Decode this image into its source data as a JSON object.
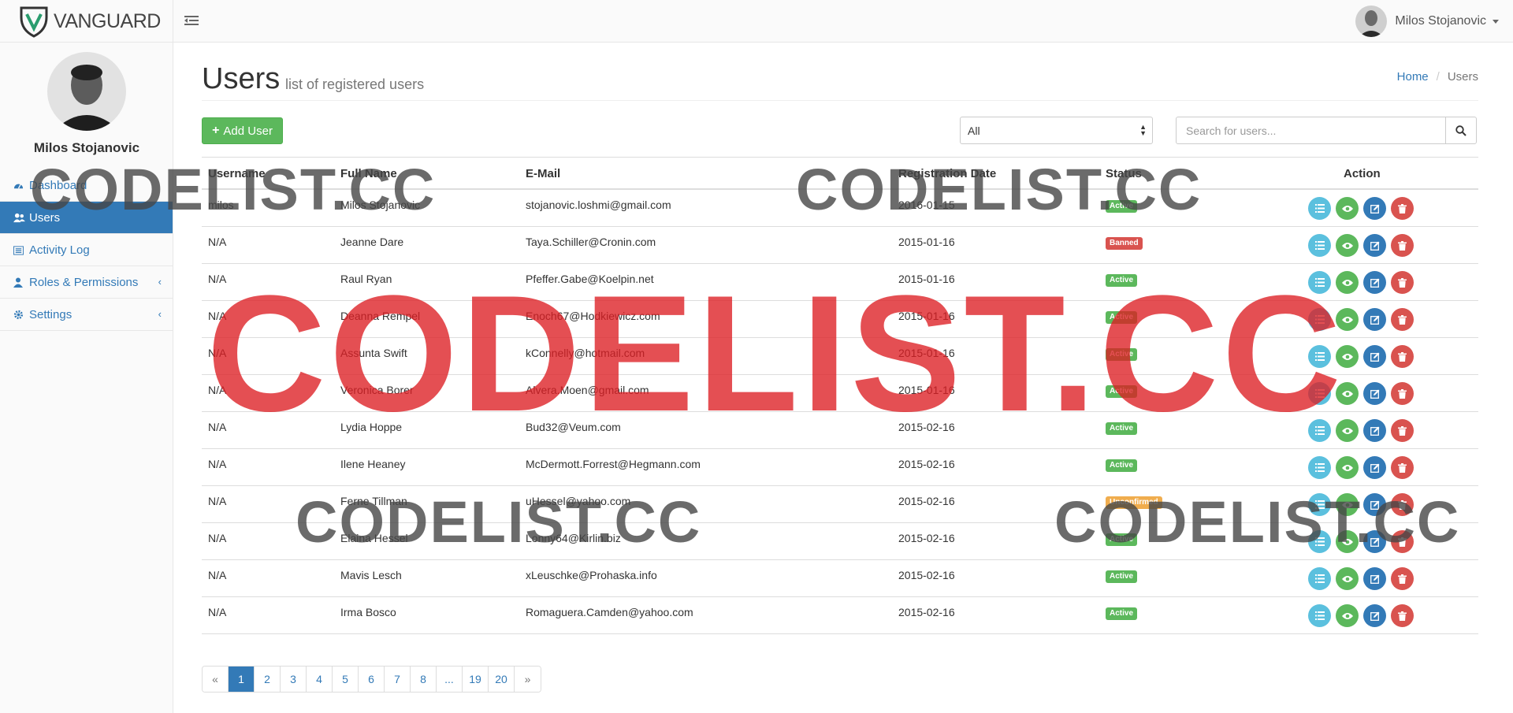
{
  "brand": {
    "name": "VANGUARD"
  },
  "topbar": {
    "user_name": "Milos Stojanovic"
  },
  "sidebar": {
    "user_name": "Milos Stojanovic",
    "items": [
      {
        "label": "Dashboard",
        "icon": "dashboard-icon",
        "active": false,
        "has_submenu": false
      },
      {
        "label": "Users",
        "icon": "users-icon",
        "active": true,
        "has_submenu": false
      },
      {
        "label": "Activity Log",
        "icon": "list-icon",
        "active": false,
        "has_submenu": false
      },
      {
        "label": "Roles & Permissions",
        "icon": "user-icon",
        "active": false,
        "has_submenu": true
      },
      {
        "label": "Settings",
        "icon": "gear-icon",
        "active": false,
        "has_submenu": true
      }
    ]
  },
  "page": {
    "title": "Users",
    "subtitle": "list of registered users"
  },
  "breadcrumb": {
    "home": "Home",
    "separator": "/",
    "current": "Users"
  },
  "toolbar": {
    "add_label": "Add User",
    "filter_value": "All",
    "search_placeholder": "Search for users..."
  },
  "table": {
    "headers": {
      "username": "Username",
      "full_name": "Full Name",
      "email": "E-Mail",
      "reg_date": "Registration Date",
      "status": "Status",
      "action": "Action"
    },
    "rows": [
      {
        "username": "milos",
        "full_name": "Milos Stojanovic",
        "email": "stojanovic.loshmi@gmail.com",
        "date": "2016-01-15",
        "status": "Active"
      },
      {
        "username": "N/A",
        "full_name": "Jeanne Dare",
        "email": "Taya.Schiller@Cronin.com",
        "date": "2015-01-16",
        "status": "Banned"
      },
      {
        "username": "N/A",
        "full_name": "Raul Ryan",
        "email": "Pfeffer.Gabe@Koelpin.net",
        "date": "2015-01-16",
        "status": "Active"
      },
      {
        "username": "N/A",
        "full_name": "Deanna Rempel",
        "email": "Enoch67@Hodkiewicz.com",
        "date": "2015-01-16",
        "status": "Active"
      },
      {
        "username": "N/A",
        "full_name": "Assunta Swift",
        "email": "kConnelly@hotmail.com",
        "date": "2015-01-16",
        "status": "Active"
      },
      {
        "username": "N/A",
        "full_name": "Veronica Borer",
        "email": "Alvera.Moen@gmail.com",
        "date": "2015-01-16",
        "status": "Active"
      },
      {
        "username": "N/A",
        "full_name": "Lydia Hoppe",
        "email": "Bud32@Veum.com",
        "date": "2015-02-16",
        "status": "Active"
      },
      {
        "username": "N/A",
        "full_name": "Ilene Heaney",
        "email": "McDermott.Forrest@Hegmann.com",
        "date": "2015-02-16",
        "status": "Active"
      },
      {
        "username": "N/A",
        "full_name": "Ferne Tillman",
        "email": "uHessel@yahoo.com",
        "date": "2015-02-16",
        "status": "Unconfirmed"
      },
      {
        "username": "N/A",
        "full_name": "Elaina Hessel",
        "email": "Lonny64@Kirlin.biz",
        "date": "2015-02-16",
        "status": "Active"
      },
      {
        "username": "N/A",
        "full_name": "Mavis Lesch",
        "email": "xLeuschke@Prohaska.info",
        "date": "2015-02-16",
        "status": "Active"
      },
      {
        "username": "N/A",
        "full_name": "Irma Bosco",
        "email": "Romaguera.Camden@yahoo.com",
        "date": "2015-02-16",
        "status": "Active"
      }
    ],
    "row_actions": [
      "list-icon",
      "eye-icon",
      "edit-icon",
      "trash-icon"
    ]
  },
  "pagination": {
    "pages": [
      "«",
      "1",
      "2",
      "3",
      "4",
      "5",
      "6",
      "7",
      "8",
      "...",
      "19",
      "20",
      "»"
    ],
    "current": "1"
  },
  "watermarks": {
    "grey": "CODELIST.CC",
    "red": "CODELIST.CC"
  },
  "colors": {
    "primary": "#337ab7",
    "success": "#5cb85c",
    "danger": "#d9534f",
    "warning": "#f0ad4e",
    "info": "#5bc0de",
    "brand_green": "#2a9d6e"
  }
}
